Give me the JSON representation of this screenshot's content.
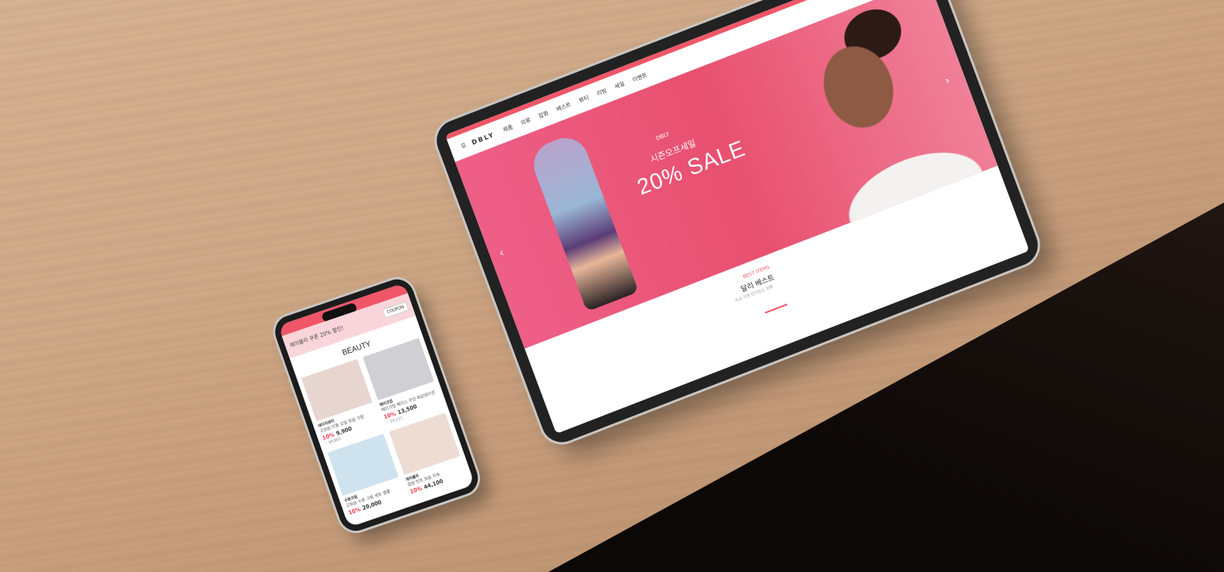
{
  "tablet": {
    "logo": "DBLY",
    "nav": [
      "제품",
      "의류",
      "잡화",
      "베스트",
      "뷰티",
      "리빙",
      "세일",
      "이벤트"
    ],
    "icons": [
      "search-icon",
      "user-icon",
      "cart-icon",
      "heart-icon",
      "menu-icon"
    ],
    "hero": {
      "small_label": "DBLY",
      "subtitle": "시즌오프세일",
      "headline": "20% SALE",
      "prev": "‹",
      "next": "›"
    },
    "section": {
      "label": "BEST ITEMS",
      "title": "달리 베스트",
      "desc": "지금 가장 인기있는 상품"
    }
  },
  "phone": {
    "banner_text": "에이블리 쿠폰 20% 할인!",
    "coupon_label": "COUPON",
    "section_title": "BEAUTY",
    "products": [
      {
        "brand": "데이지뷰티",
        "name": "고보습 미용 오일 보습 크림",
        "discount": "10%",
        "price": "9,900",
        "likes": "89,805",
        "img_color": "#e7d6cf"
      },
      {
        "brand": "메이크업",
        "name": "메이크업 베이스 쿠션 파운데이션",
        "discount": "10%",
        "price": "13,500",
        "likes": "24,111",
        "img_color": "#cfcfd4"
      },
      {
        "brand": "수분크림",
        "name": "고보습 수분 크림 세트 앰플",
        "discount": "10%",
        "price": "20,000",
        "likes": "",
        "img_color": "#cfe3ee"
      },
      {
        "brand": "에이블리",
        "name": "립밤 틴트 보습 지속",
        "discount": "10%",
        "price": "44,100",
        "likes": "",
        "img_color": "#ecdcd4"
      }
    ]
  }
}
